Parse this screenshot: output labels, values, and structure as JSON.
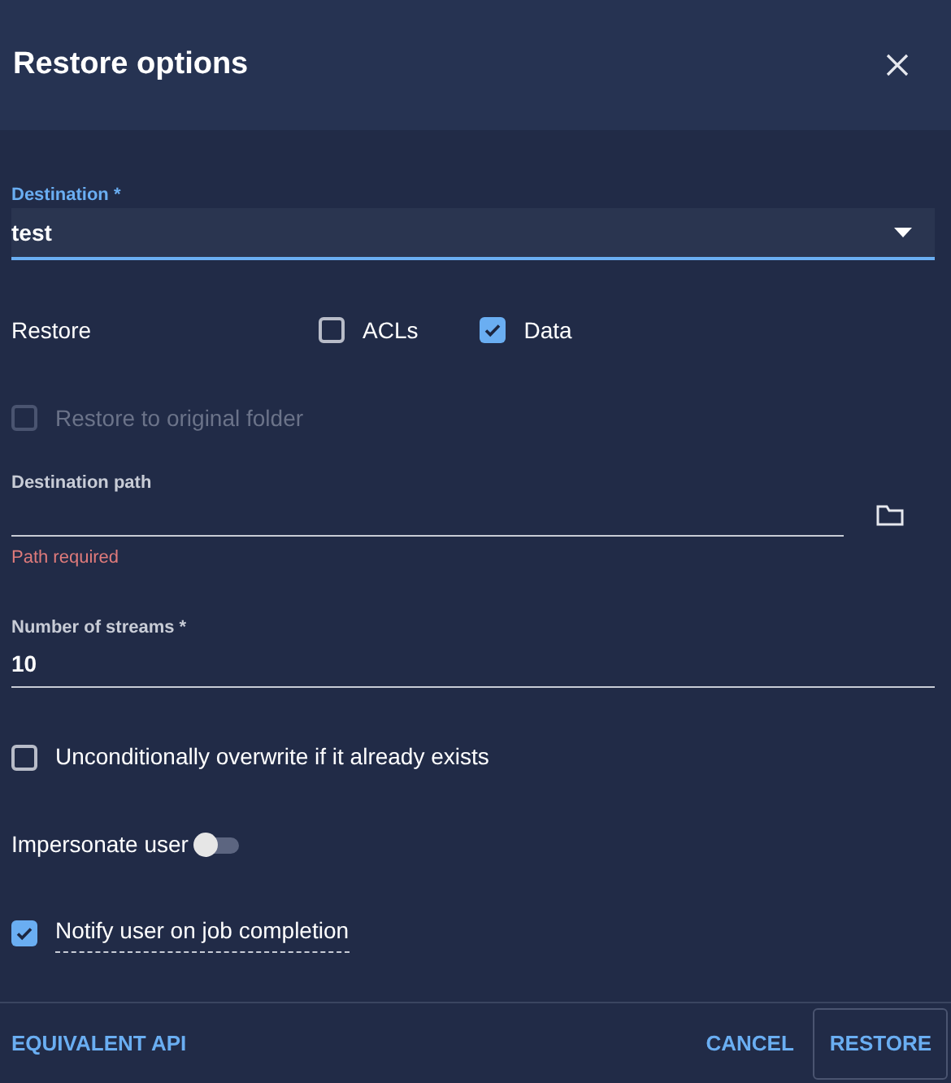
{
  "dialog": {
    "title": "Restore options"
  },
  "destination": {
    "label": "Destination *",
    "value": "test",
    "focused": true
  },
  "restore": {
    "label": "Restore",
    "options": [
      {
        "label": "ACLs",
        "checked": false
      },
      {
        "label": "Data",
        "checked": true
      }
    ]
  },
  "restore_to_original": {
    "label": "Restore to original folder",
    "checked": false,
    "disabled": true
  },
  "destination_path": {
    "label": "Destination path",
    "error": "Path required"
  },
  "streams": {
    "label": "Number of streams *",
    "value": "10"
  },
  "overwrite": {
    "label": "Unconditionally overwrite if it already exists",
    "checked": false
  },
  "impersonate": {
    "label": "Impersonate user",
    "on": false
  },
  "notify": {
    "label": "Notify user on job completion",
    "checked": true
  },
  "footer": {
    "buttons": [
      {
        "label": "EQUIVALENT API",
        "kind": "text"
      },
      {
        "label": "CANCEL",
        "kind": "text"
      },
      {
        "label": "RESTORE",
        "kind": "outlined"
      }
    ]
  }
}
